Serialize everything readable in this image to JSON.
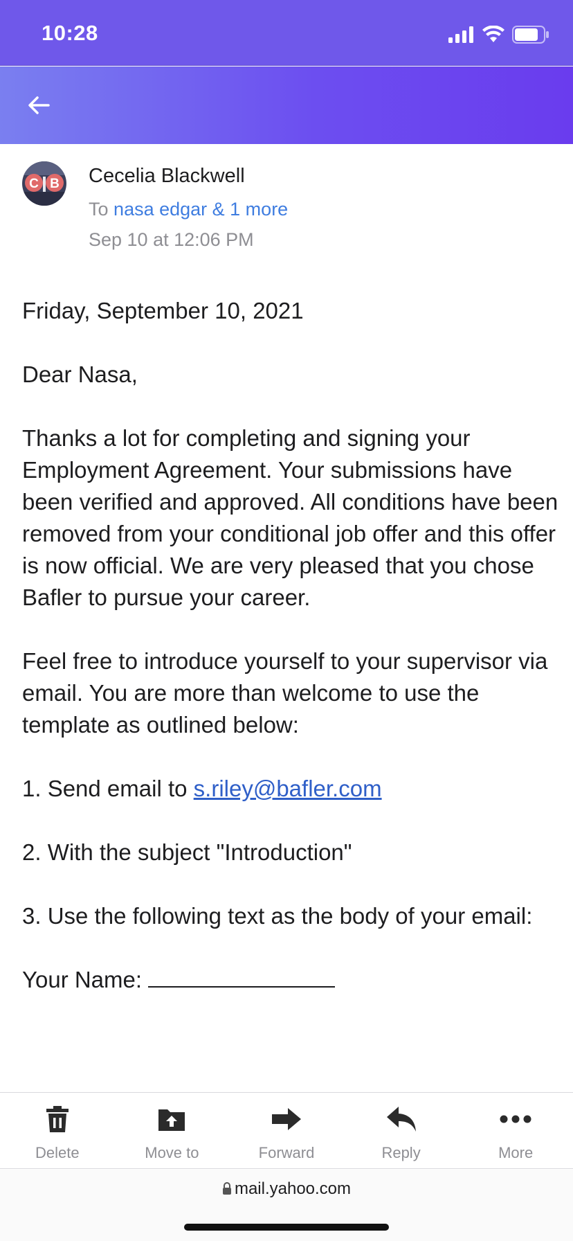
{
  "status_bar": {
    "time": "10:28"
  },
  "header": {
    "back_icon": "arrow-left-icon"
  },
  "sender": {
    "initials": "C B",
    "name": "Cecelia Blackwell",
    "to_prefix": "To",
    "recipients": "nasa edgar & 1 more",
    "date": "Sep 10 at 12:06 PM"
  },
  "body": {
    "date_line": "Friday, September 10, 2021",
    "greeting": "Dear Nasa,",
    "paragraph1": "Thanks a lot for completing and signing your Employment Agreement. Your submissions have been verified and approved. All conditions have been removed from your conditional job offer and this offer is now official. We are very pleased that you chose Bafler to pursue your career.",
    "paragraph2": "Feel free to introduce yourself to your supervisor via email. You are more than welcome to use the template as outlined below:",
    "step1_prefix": "1. Send email to ",
    "step1_email": "s.riley@bafler.com",
    "step2": "2. With the subject \"Introduction\"",
    "step3": "3. Use the following text as the body of your email:",
    "your_name_label": "Your Name: "
  },
  "toolbar": {
    "items": [
      {
        "label": "Delete",
        "icon": "trash-icon"
      },
      {
        "label": "Move to",
        "icon": "folder-move-icon"
      },
      {
        "label": "Forward",
        "icon": "forward-arrow-icon"
      },
      {
        "label": "Reply",
        "icon": "reply-arrow-icon"
      },
      {
        "label": "More",
        "icon": "more-dots-icon"
      }
    ]
  },
  "browser": {
    "url": "mail.yahoo.com"
  },
  "colors": {
    "header_start": "#7a7ff0",
    "header_end": "#6a3cee",
    "link": "#3f7de0",
    "status_bar": "#6f58ea"
  }
}
